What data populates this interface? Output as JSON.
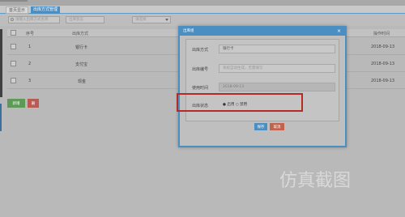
{
  "tabs": [
    {
      "label": "首页显示"
    },
    {
      "label": "出库方式管理"
    }
  ],
  "toolbar": {
    "search_placeholder": "请输入出库方式名称",
    "filter_placeholder": "出库状态",
    "select_value": "请选择"
  },
  "grid": {
    "columns": [
      "序号",
      "出库方式",
      "操作时间"
    ],
    "rows": [
      {
        "index": "1",
        "name": "银行卡",
        "time": "2018-09-13"
      },
      {
        "index": "2",
        "name": "支付宝",
        "time": "2018-09-13"
      },
      {
        "index": "3",
        "name": "现金",
        "time": "2018-09-13"
      }
    ]
  },
  "actions": {
    "add": "新增",
    "delete": "删"
  },
  "dialog": {
    "title": "出库组",
    "close_icon": "×",
    "fields": [
      {
        "label": "出库方式",
        "value": "银行卡",
        "kind": "normal"
      },
      {
        "label": "出库编号",
        "value": "系统自动生成，无需填写",
        "kind": "placeholder"
      },
      {
        "label": "使用时间",
        "value": "2018-09-13",
        "kind": "readonly"
      },
      {
        "label": "出库状态",
        "value": "● 启用 ○ 禁用",
        "kind": "radio"
      }
    ],
    "save": "保存",
    "cancel": "取消"
  },
  "watermark_text": "仿真截图"
}
